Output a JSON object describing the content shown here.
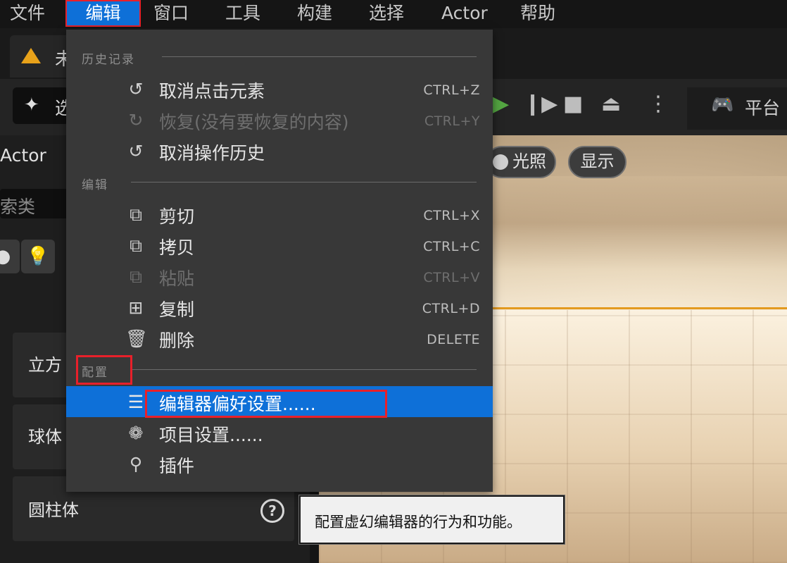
{
  "menubar": {
    "items": [
      "文件",
      "编辑",
      "窗口",
      "工具",
      "构建",
      "选择",
      "Actor",
      "帮助"
    ],
    "active": "编辑"
  },
  "doc_tab": {
    "label": "未"
  },
  "toolbar": {
    "select_label": "选",
    "platform_label": "平台"
  },
  "left_panel": {
    "actor_label": "Actor",
    "search_placeholder": "索类",
    "items": [
      "立方",
      "球体",
      "圆柱体"
    ]
  },
  "viewport": {
    "lighting_label": "光照",
    "show_label": "显示"
  },
  "edit_menu": {
    "sections": {
      "history": "历史记录",
      "edit": "编辑",
      "config": "配置"
    },
    "history_items": [
      {
        "label": "取消点击元素",
        "shortcut": "CTRL+Z",
        "icon": "undo-icon",
        "enabled": true
      },
      {
        "label": "恢复(没有要恢复的内容)",
        "shortcut": "CTRL+Y",
        "icon": "redo-icon",
        "enabled": false
      },
      {
        "label": "取消操作历史",
        "shortcut": "",
        "icon": "undo-history-icon",
        "enabled": true
      }
    ],
    "edit_items": [
      {
        "label": "剪切",
        "shortcut": "CTRL+X",
        "icon": "cut-icon",
        "enabled": true
      },
      {
        "label": "拷贝",
        "shortcut": "CTRL+C",
        "icon": "copy-icon",
        "enabled": true
      },
      {
        "label": "粘贴",
        "shortcut": "CTRL+V",
        "icon": "paste-icon",
        "enabled": false
      },
      {
        "label": "复制",
        "shortcut": "CTRL+D",
        "icon": "duplicate-icon",
        "enabled": true
      },
      {
        "label": "删除",
        "shortcut": "DELETE",
        "icon": "trash-icon",
        "enabled": true
      }
    ],
    "config_items": [
      {
        "label": "编辑器偏好设置......",
        "icon": "sliders-icon",
        "highlighted": true
      },
      {
        "label": "项目设置......",
        "icon": "project-settings-icon",
        "highlighted": false
      },
      {
        "label": "插件",
        "icon": "plugin-icon",
        "highlighted": false
      }
    ]
  },
  "tooltip": {
    "text": "配置虚幻编辑器的行为和功能。"
  },
  "colors": {
    "accent": "#0e70d8",
    "annotation_red": "#e8202a",
    "menu_bg": "#383838"
  }
}
